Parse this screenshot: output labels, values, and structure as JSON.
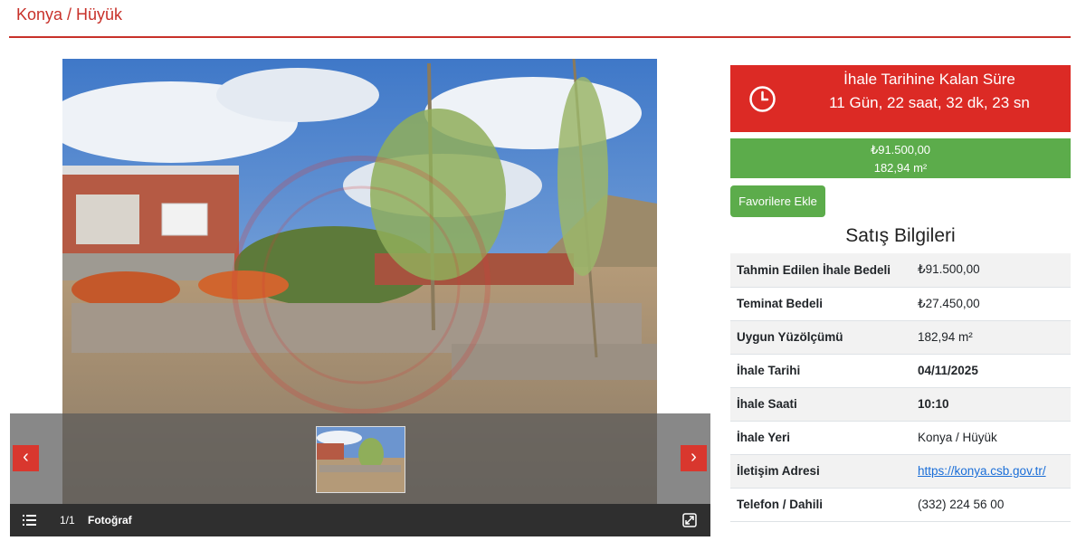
{
  "page": {
    "title": "Konya / Hüyük"
  },
  "gallery": {
    "counter": "1/1",
    "label": "Fotoğraf",
    "prev": "‹",
    "next": "›"
  },
  "countdown": {
    "title": "İhale Tarihine Kalan Süre",
    "time": "11 Gün, 22 saat, 32 dk, 23 sn"
  },
  "price": {
    "amount": "₺91.500,00",
    "area": "182,94 m²"
  },
  "favorite_button": "Favorilere Ekle",
  "sale_info": {
    "title": "Satış Bilgileri",
    "rows": [
      {
        "label": "Tahmin Edilen İhale Bedeli",
        "value": "₺91.500,00"
      },
      {
        "label": "Teminat Bedeli",
        "value": "₺27.450,00"
      },
      {
        "label": "Uygun Yüzölçümü",
        "value": "182,94 m²"
      },
      {
        "label": "İhale Tarihi",
        "value": "04/11/2025"
      },
      {
        "label": "İhale Saati",
        "value": "10:10"
      },
      {
        "label": "İhale Yeri",
        "value": "Konya / Hüyük"
      },
      {
        "label": "İletişim Adresi",
        "value": "https://konya.csb.gov.tr/"
      },
      {
        "label": "Telefon / Dahili",
        "value": "(332) 224 56 00"
      }
    ]
  },
  "colors": {
    "accent": "#c8312a",
    "countdown": "#dc2a25",
    "success": "#5cac4b",
    "link": "#1a6ed8"
  }
}
